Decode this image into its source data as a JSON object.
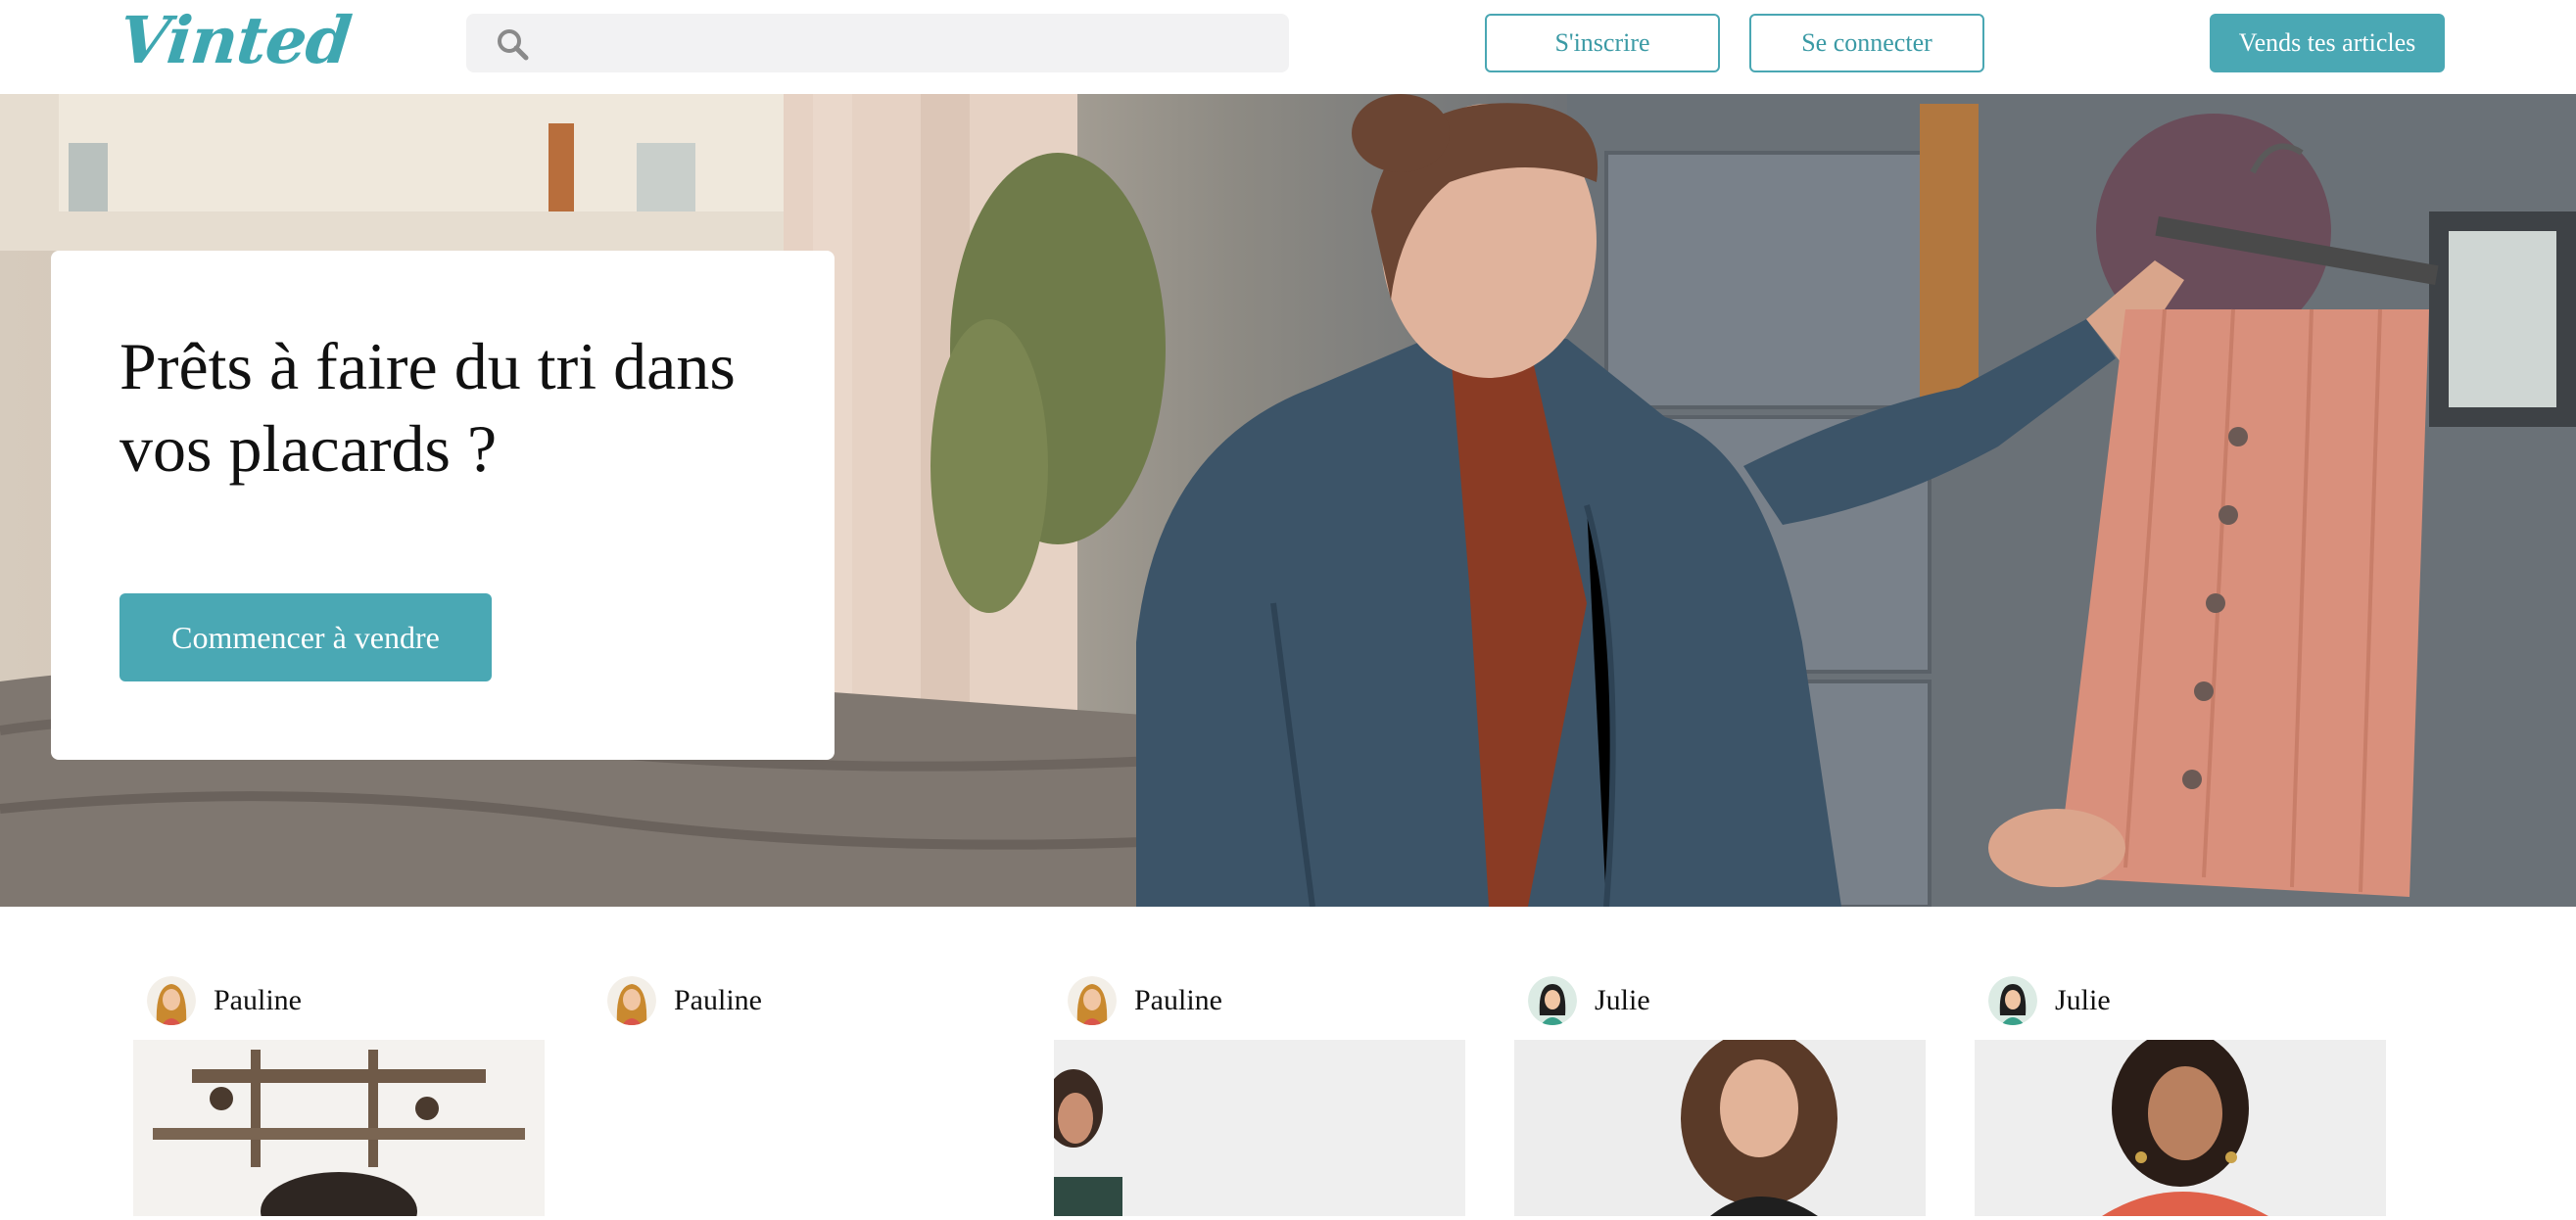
{
  "header": {
    "logo": "Vinted",
    "search": {
      "value": "",
      "placeholder": ""
    },
    "signup_label": "S'inscrire",
    "login_label": "Se connecter",
    "sell_label": "Vends tes articles"
  },
  "hero": {
    "title": "Prêts à faire du tri dans vos placards ?",
    "cta_label": "Commencer à vendre"
  },
  "feed": {
    "items": [
      {
        "user": "Pauline",
        "avatar": "avatar-pauline"
      },
      {
        "user": "Pauline",
        "avatar": "avatar-pauline"
      },
      {
        "user": "Pauline",
        "avatar": "avatar-pauline"
      },
      {
        "user": "Julie",
        "avatar": "avatar-julie"
      },
      {
        "user": "Julie",
        "avatar": "avatar-julie"
      }
    ]
  },
  "colors": {
    "brand": "#4aa8b4",
    "brand_text": "#3b9aa5"
  }
}
